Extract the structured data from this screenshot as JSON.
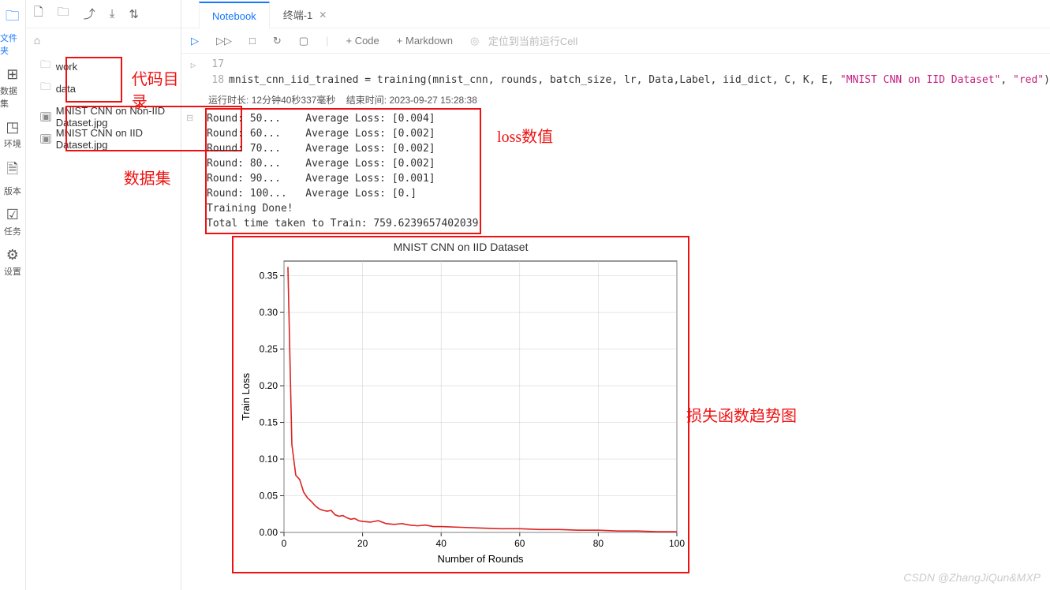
{
  "rail": {
    "items": [
      {
        "icon": "🗀",
        "label": "文件夹",
        "active": true
      },
      {
        "icon": "⊞",
        "label": "数据集"
      },
      {
        "icon": "◳",
        "label": "环境"
      },
      {
        "icon": "🗎",
        "label": "版本"
      },
      {
        "icon": "☑",
        "label": "任务"
      },
      {
        "icon": "⚙",
        "label": "设置"
      }
    ]
  },
  "sidebar": {
    "toolbar_icons": [
      "new-file",
      "new-folder",
      "upload",
      "download",
      "sort"
    ],
    "home_icon": "⌂",
    "folders": [
      {
        "icon": "folder",
        "label": "work"
      },
      {
        "icon": "folder",
        "label": "data"
      }
    ],
    "files": [
      {
        "icon": "image",
        "label": "MNIST CNN on Non-IID Dataset.jpg"
      },
      {
        "icon": "image",
        "label": "MNIST CNN on IID Dataset.jpg"
      }
    ]
  },
  "annotations": {
    "code_dir": "代码目录",
    "dataset": "数据集",
    "loss_value": "loss数值",
    "trend": "损失函数趋势图"
  },
  "tabs": [
    {
      "label": "Notebook",
      "active": true
    },
    {
      "label": "终端-1",
      "closable": true
    }
  ],
  "nb_toolbar": {
    "run": "▷",
    "fast": "▷▷",
    "stop": "□",
    "restart": "↻",
    "interrupt": "▢",
    "add_code": "+ Code",
    "add_md": "+ Markdown",
    "locate": "定位到当前运行Cell",
    "locate_icon": "◎"
  },
  "code": {
    "lines": [
      {
        "n": "17",
        "text": ""
      },
      {
        "n": "18",
        "text": "mnist_cnn_iid_trained = training(mnist_cnn, rounds, batch_size, lr, Data,Label, iid_dict, C, K, E, \"MNIST CNN on IID Dataset\", \"red\")"
      }
    ]
  },
  "status": {
    "runtime_label": "运行时长:",
    "runtime_value": "12分钟40秒337毫秒",
    "endtime_label": "结束时间:",
    "endtime_value": "2023-09-27 15:28:38"
  },
  "output_lines": [
    "Round: 50...    Average Loss: [0.004]",
    "Round: 60...    Average Loss: [0.002]",
    "Round: 70...    Average Loss: [0.002]",
    "Round: 80...    Average Loss: [0.002]",
    "Round: 90...    Average Loss: [0.001]",
    "Round: 100...   Average Loss: [0.]",
    "Training Done!",
    "Total time taken to Train: 759.6239657402039"
  ],
  "watermark": "CSDN @ZhangJiQun&MXP",
  "chart_data": {
    "type": "line",
    "title": "MNIST CNN on IID Dataset",
    "xlabel": "Number of Rounds",
    "ylabel": "Train Loss",
    "xlim": [
      0,
      100
    ],
    "ylim": [
      0,
      0.37
    ],
    "xticks": [
      0,
      20,
      40,
      60,
      80,
      100
    ],
    "yticks": [
      0.0,
      0.05,
      0.1,
      0.15,
      0.2,
      0.25,
      0.3,
      0.35
    ],
    "color": "#d22",
    "x": [
      1,
      2,
      3,
      4,
      5,
      6,
      7,
      8,
      9,
      10,
      11,
      12,
      13,
      14,
      15,
      16,
      17,
      18,
      19,
      20,
      22,
      24,
      26,
      28,
      30,
      32,
      34,
      36,
      38,
      40,
      45,
      50,
      55,
      60,
      65,
      70,
      75,
      80,
      85,
      90,
      95,
      100
    ],
    "values": [
      0.362,
      0.12,
      0.078,
      0.072,
      0.055,
      0.047,
      0.042,
      0.036,
      0.032,
      0.03,
      0.029,
      0.03,
      0.024,
      0.022,
      0.023,
      0.02,
      0.018,
      0.019,
      0.016,
      0.015,
      0.014,
      0.016,
      0.012,
      0.011,
      0.012,
      0.01,
      0.009,
      0.01,
      0.008,
      0.008,
      0.007,
      0.006,
      0.005,
      0.005,
      0.004,
      0.004,
      0.003,
      0.003,
      0.002,
      0.002,
      0.001,
      0.001
    ]
  }
}
